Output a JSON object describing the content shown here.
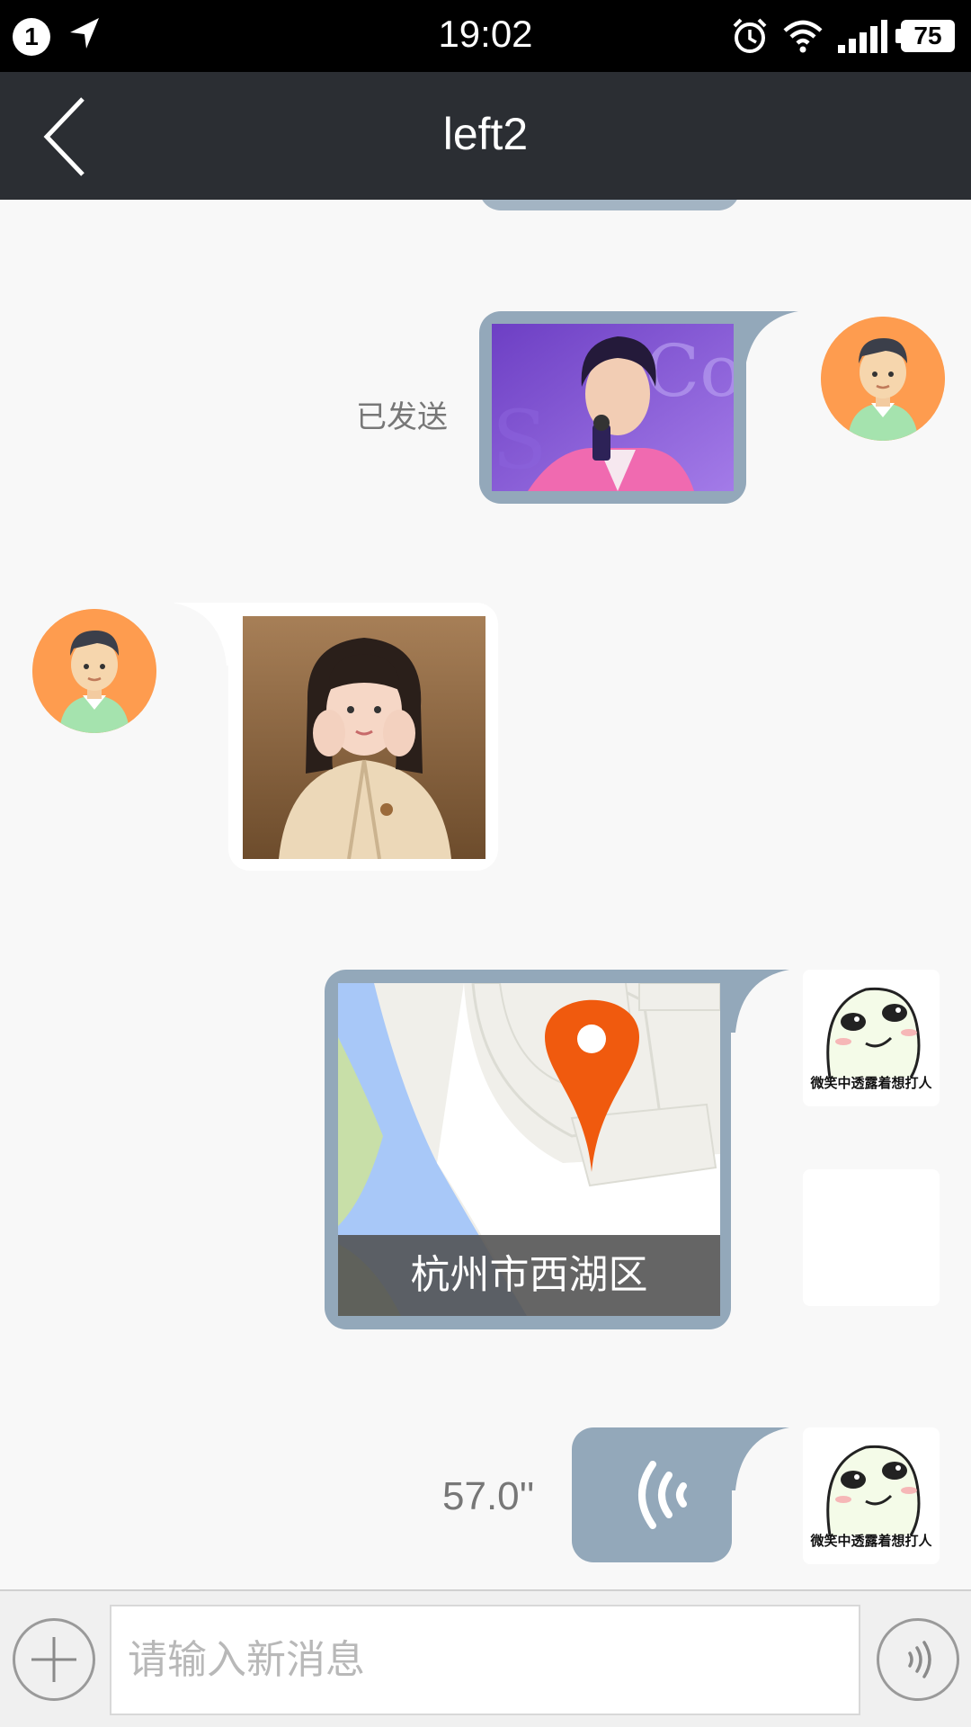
{
  "status_bar": {
    "notification_count": "1",
    "time": "19:02",
    "battery": "75",
    "icons": [
      "location-arrow-icon",
      "alarm-icon",
      "wifi-icon",
      "signal-icon",
      "battery-icon"
    ]
  },
  "header": {
    "title": "left2",
    "back_icon": "chevron-left-icon"
  },
  "messages": [
    {
      "side": "right",
      "type": "image",
      "status": "已发送",
      "sender_avatar": "man-avatar"
    },
    {
      "side": "left",
      "type": "image",
      "sender_avatar": "man-avatar"
    },
    {
      "side": "right",
      "type": "location",
      "location_label": "杭州市西湖区",
      "sender_avatar": "meme-avatar",
      "avatar_caption": "微笑中透露着想打人"
    },
    {
      "side": "right",
      "type": "voice",
      "duration": "57.0''",
      "sender_avatar": "meme-avatar",
      "avatar_caption": "微笑中透露着想打人"
    }
  ],
  "input_bar": {
    "placeholder": "请输入新消息",
    "value": "",
    "plus_icon": "plus-icon",
    "voice_icon": "voice-icon"
  },
  "colors": {
    "status_bar": "#000000",
    "title_bar": "#2b2e33",
    "chat_background": "#f8f8f8",
    "outgoing_bubble": "#93a8ba",
    "incoming_bubble": "#ffffff",
    "avatar_background": "#fe9c4f",
    "map_pin": "#f05a0e"
  }
}
